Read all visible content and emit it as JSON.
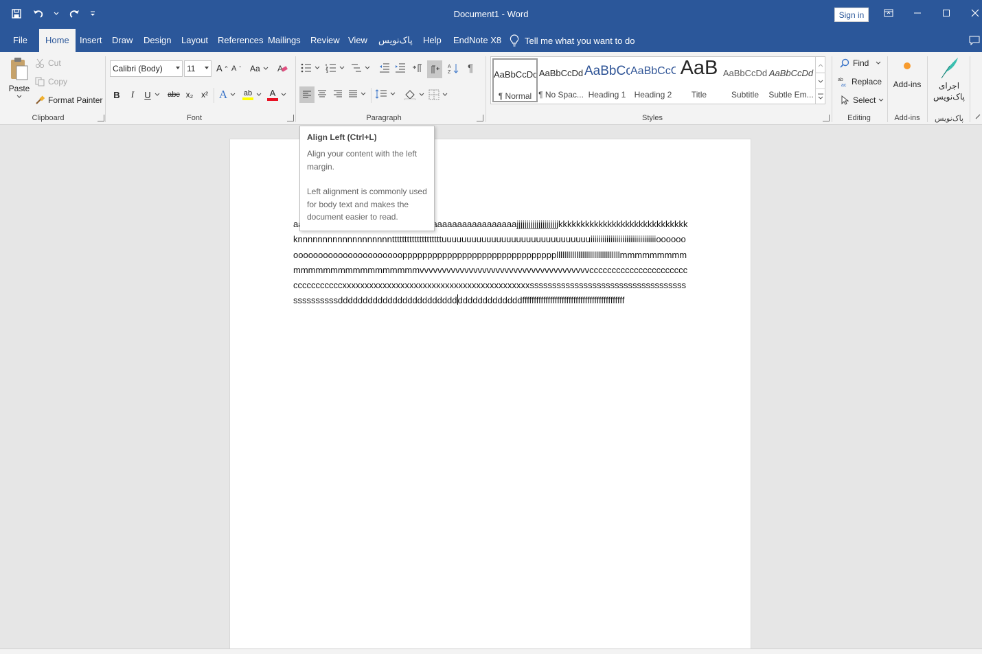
{
  "titlebar": {
    "document_title": "Document1  -  Word",
    "sign_in": "Sign in",
    "qat": [
      "save-icon",
      "undo-icon",
      "redo-icon",
      "customize-icon"
    ]
  },
  "tabs": [
    {
      "label": "File"
    },
    {
      "label": "Home"
    },
    {
      "label": "Insert"
    },
    {
      "label": "Draw"
    },
    {
      "label": "Design"
    },
    {
      "label": "Layout"
    },
    {
      "label": "References"
    },
    {
      "label": "Mailings"
    },
    {
      "label": "Review"
    },
    {
      "label": "View"
    },
    {
      "label": "پاک‌نویس"
    },
    {
      "label": "Help"
    },
    {
      "label": "EndNote X8"
    }
  ],
  "tell_me": "Tell me what you want to do",
  "clipboard": {
    "group": "Clipboard",
    "paste": "Paste",
    "cut": "Cut",
    "copy": "Copy",
    "format_painter": "Format Painter"
  },
  "font": {
    "group": "Font",
    "family": "Calibri (Body)",
    "size": "11",
    "bold": "B",
    "italic": "I",
    "underline": "U",
    "strike": "abc",
    "subscript": "x₂",
    "superscript": "x²",
    "change_case": "Aa",
    "grow": "A",
    "shrink": "A",
    "text_effects": "A",
    "highlight": "ab",
    "font_color": "A"
  },
  "paragraph": {
    "group": "Paragraph"
  },
  "styles": {
    "group": "Styles",
    "items": [
      {
        "preview": "AaBbCcDd",
        "name": "¶ Normal"
      },
      {
        "preview": "AaBbCcDd",
        "name": "¶ No Spac..."
      },
      {
        "preview": "AaBbCc",
        "name": "Heading 1"
      },
      {
        "preview": "AaBbCcC",
        "name": "Heading 2"
      },
      {
        "preview": "AaB",
        "name": "Title"
      },
      {
        "preview": "AaBbCcDd",
        "name": "Subtitle"
      },
      {
        "preview": "AaBbCcDd",
        "name": "Subtle Em..."
      }
    ]
  },
  "editing": {
    "group": "Editing",
    "find": "Find",
    "replace": "Replace",
    "select": "Select"
  },
  "addins": {
    "group": "Add-ins",
    "label": "Add-ins"
  },
  "pakneviss": {
    "group": "پاک‌نویس",
    "label_line1": "اجرای",
    "label_line2": "پاک‌نویس"
  },
  "tooltip": {
    "title": "Align Left (Ctrl+L)",
    "line1": "Align your content with the left margin.",
    "line2": "Left alignment is commonly used for body text and makes the document easier to read."
  },
  "document": {
    "text_before_caret": "aaaaaaaaaaaaaaaaaaaaaaaaaaaaaaaaaaaaaaaaaaaaajjjjjjjjjjjjjjjjjjjjjkkkkkkkkkkkkkkkkkkkkkkkkkkkkkknnnnnnnnnnnnnnnnnnnttttttttttttttttttttuuuuuuuuuuuuuuuuuuuuuuuuuuuuuuiiiiiiiiiiiiiiiiiiiiiiiiiiiiiiiiioooooooooooooooooooooooooooopppppppppppppppppppppppppppppppllllllllllllllllllllllllllllllllmmmmmmmmmmmmmmmmmmmmmmmmmmvvvvvvvvvvvvvvvvvvvvvvvvvvvvvvvvvvvvvvcccccccccccccccccccccccccccccccccxxxxxxxxxxxxxxxxxxxxxxxxxxxxxxxxxxxxxxxxxxsssssssssssssssssssssssssssssssssssssssssssssdddddddddddddddddddddddd",
    "text_after_caret": "dddddddddddddffffffffffffffffffffffffffffffffffffffffffff"
  },
  "colors": {
    "brand": "#2b579a",
    "highlight": "#ffff00",
    "font_color": "#e81123"
  }
}
